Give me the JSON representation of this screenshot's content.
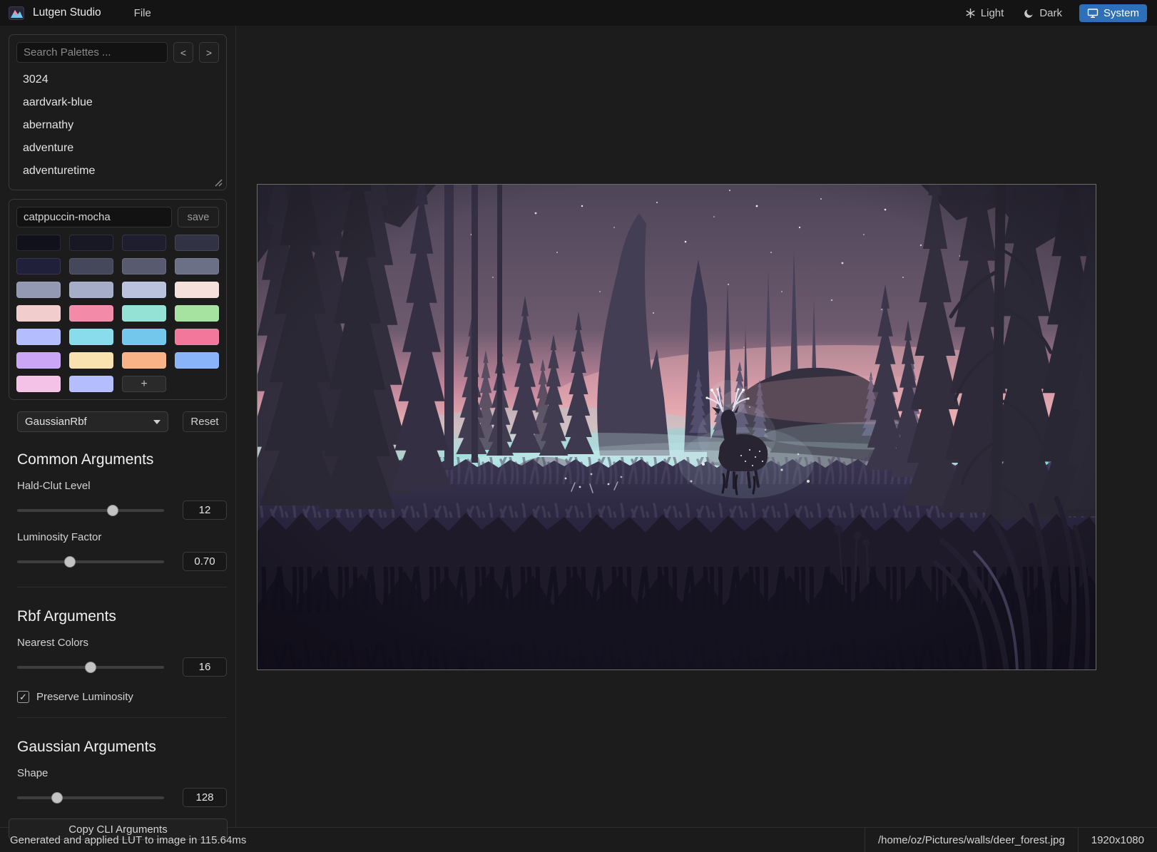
{
  "app": {
    "title": "Lutgen Studio",
    "menu_file": "File",
    "theme": {
      "light_label": "Light",
      "dark_label": "Dark",
      "system_label": "System"
    }
  },
  "palette_browser": {
    "search_placeholder": "Search Palettes ...",
    "prev_label": "<",
    "next_label": ">",
    "items": [
      "3024",
      "aardvark-blue",
      "abernathy",
      "adventure",
      "adventuretime"
    ]
  },
  "palette_editor": {
    "name_value": "catppuccin-mocha",
    "save_label": "save",
    "add_label": "+",
    "swatches": [
      "#11111b",
      "#181825",
      "#1e1e2e",
      "#313244",
      "#20203a",
      "#45475a",
      "#585b70",
      "#6c7086",
      "#9399b2",
      "#a6adc8",
      "#bac2de",
      "#f5e0dc",
      "#f2cdcd",
      "#f38ba8",
      "#94e2d5",
      "#a6e3a1",
      "#b4befe",
      "#89dceb",
      "#74c7ec",
      "#f3779b",
      "#cba6f7",
      "#f9e2af",
      "#fab387",
      "#89b4fa",
      "#f5c2e7",
      "#b4befe"
    ]
  },
  "algorithm": {
    "selected": "GaussianRbf",
    "reset_label": "Reset"
  },
  "controls": {
    "common_heading": "Common Arguments",
    "hald_clut": {
      "label": "Hald-Clut Level",
      "value": "12",
      "percent": 65
    },
    "luminosity": {
      "label": "Luminosity Factor",
      "value": "0.70",
      "percent": 36
    },
    "rbf_heading": "Rbf Arguments",
    "nearest_colors": {
      "label": "Nearest Colors",
      "value": "16",
      "percent": 50
    },
    "preserve_luminosity": {
      "label": "Preserve Luminosity",
      "checked": true,
      "check_glyph": "✓"
    },
    "gaussian_heading": "Gaussian Arguments",
    "shape": {
      "label": "Shape",
      "value": "128",
      "percent": 27
    },
    "copy_cli_label": "Copy CLI Arguments"
  },
  "status_bar": {
    "message": "Generated and applied LUT to image in 115.64ms",
    "file_path": "/home/oz/Pictures/walls/deer_forest.jpg",
    "resolution": "1920x1080"
  },
  "colors": {
    "accent_active": "#2d6fb8"
  }
}
